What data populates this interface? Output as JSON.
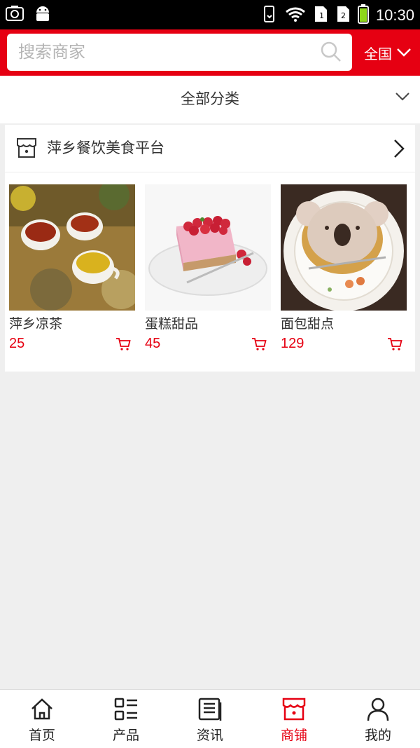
{
  "status_bar": {
    "time": "10:30",
    "icons": [
      "screenshot-icon",
      "android-icon",
      "vibrate-icon",
      "wifi-icon",
      "sim1-icon",
      "sim2-icon",
      "battery-icon"
    ]
  },
  "header": {
    "search_placeholder": "搜索商家",
    "region_label": "全国",
    "accent_color": "#e60012"
  },
  "category": {
    "label": "全部分类"
  },
  "store": {
    "name": "萍乡餐饮美食平台",
    "products": [
      {
        "name": "萍乡凉茶",
        "price": "25",
        "image": "tea-photo"
      },
      {
        "name": "蛋糕甜品",
        "price": "45",
        "image": "cake-photo"
      },
      {
        "name": "面包甜点",
        "price": "129",
        "image": "koala-dessert-photo"
      }
    ]
  },
  "bottom_nav": {
    "items": [
      {
        "label": "首页",
        "icon": "home-icon"
      },
      {
        "label": "产品",
        "icon": "list-icon"
      },
      {
        "label": "资讯",
        "icon": "news-icon"
      },
      {
        "label": "商铺",
        "icon": "shop-icon",
        "active": true
      },
      {
        "label": "我的",
        "icon": "user-icon"
      }
    ]
  }
}
